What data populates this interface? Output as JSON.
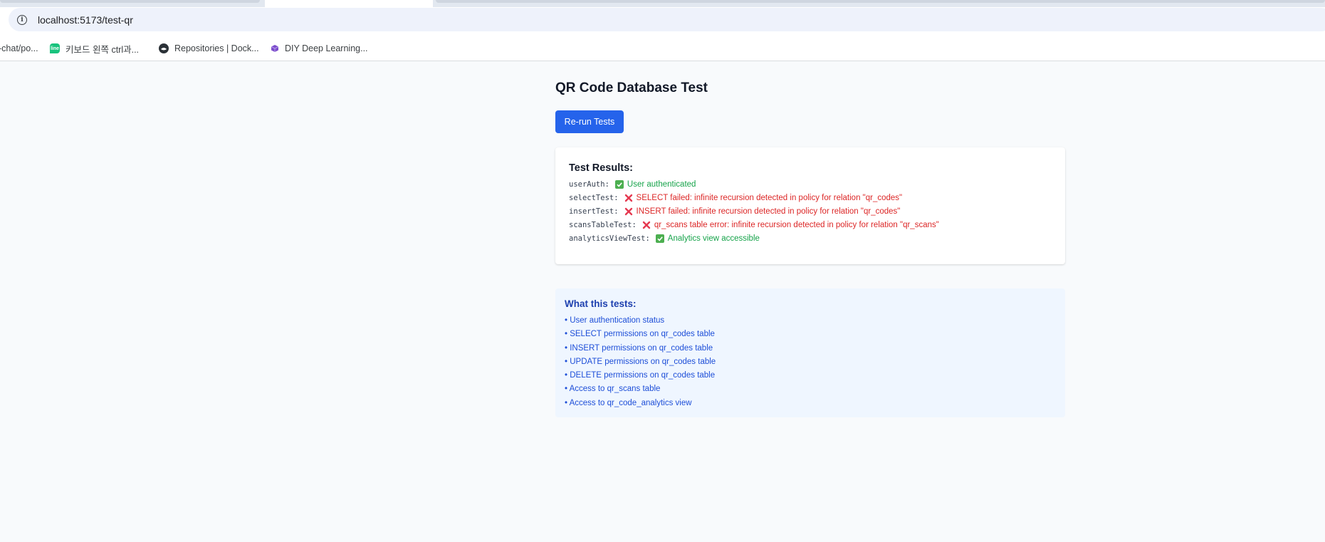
{
  "browser": {
    "url": "localhost:5173/test-qr",
    "bookmarks": [
      {
        "label": "-chat/po...",
        "icon": "none"
      },
      {
        "label": "키보드 왼쪽 ctrl과...",
        "icon": "chat-icon"
      },
      {
        "label": "Repositories | Dock...",
        "icon": "docker-icon"
      },
      {
        "label": "DIY Deep Learning...",
        "icon": "cube-icon"
      }
    ]
  },
  "page": {
    "title": "QR Code Database Test",
    "rerun_label": "Re-run Tests"
  },
  "results": {
    "title": "Test Results:",
    "rows": [
      {
        "key": "userAuth:",
        "status": "ok",
        "message": "User authenticated"
      },
      {
        "key": "selectTest:",
        "status": "fail",
        "message": "SELECT failed: infinite recursion detected in policy for relation \"qr_codes\""
      },
      {
        "key": "insertTest:",
        "status": "fail",
        "message": "INSERT failed: infinite recursion detected in policy for relation \"qr_codes\""
      },
      {
        "key": "scansTableTest:",
        "status": "fail",
        "message": "qr_scans table error: infinite recursion detected in policy for relation \"qr_scans\""
      },
      {
        "key": "analyticsViewTest:",
        "status": "ok",
        "message": "Analytics view accessible"
      }
    ]
  },
  "info": {
    "title": "What this tests:",
    "items": [
      "• User authentication status",
      "• SELECT permissions on qr_codes table",
      "• INSERT permissions on qr_codes table",
      "• UPDATE permissions on qr_codes table",
      "• DELETE permissions on qr_codes table",
      "• Access to qr_scans table",
      "• Access to qr_code_analytics view"
    ]
  },
  "colors": {
    "primary": "#2563eb",
    "success": "#16a34a",
    "error": "#dc2626",
    "info_bg": "#eff6ff",
    "info_text": "#1d4ed8"
  }
}
